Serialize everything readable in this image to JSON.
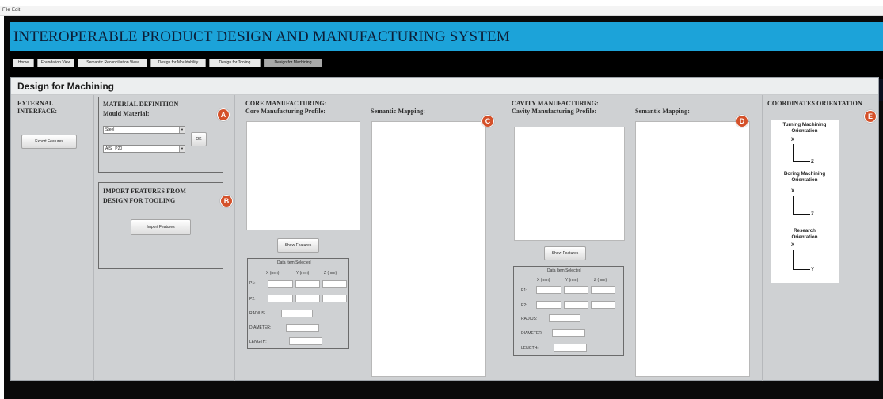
{
  "menu": {
    "file": "File",
    "edit": "Edit"
  },
  "app": {
    "title": "INTEROPERABLE PRODUCT DESIGN AND MANUFACTURING SYSTEM"
  },
  "nav": {
    "tabs": [
      {
        "label": "Home"
      },
      {
        "label": "Foundation View"
      },
      {
        "label": "Semantic Reconciliation View"
      },
      {
        "label": "Design for Mouldability"
      },
      {
        "label": "Design for Tooling"
      },
      {
        "label": "Design for Machining"
      }
    ],
    "active": "Design for Machining"
  },
  "page": {
    "title": "Design for Machining"
  },
  "external": {
    "heading_line1": "EXTERNAL",
    "heading_line2": "INTERFACE:",
    "export_button": "Export Features"
  },
  "material": {
    "heading": "MATERIAL DEFINITION",
    "mould_label": "Mould Material:",
    "material_value": "Steel",
    "grade_value": "AISI_P20",
    "ok_button": "OK"
  },
  "import": {
    "heading_line1": "IMPORT FEATURES FROM",
    "heading_line2": "DESIGN FOR TOOLING",
    "import_button": "Import Features"
  },
  "core": {
    "heading": "CORE MANUFACTURING:",
    "profile_label": "Core Manufacturing Profile:",
    "mapping_label": "Semantic Mapping:",
    "show_button": "Show Features",
    "data_title": "Data Item Selected",
    "x_label": "X (mm)",
    "y_label": "Y (mm)",
    "z_label": "Z (mm)",
    "p1": "P1:",
    "p2": "P2:",
    "radius": "RADIUS:",
    "diameter": "DIAMETER:",
    "length": "LENGTH:"
  },
  "cavity": {
    "heading": "CAVITY MANUFACTURING:",
    "profile_label": "Cavity Manufacturing Profile:",
    "mapping_label": "Semantic Mapping:",
    "show_button": "Show Features",
    "data_title": "Data Item Selected",
    "x_label": "X (mm)",
    "y_label": "Y (mm)",
    "z_label": "Z (mm)",
    "p1": "P1:",
    "p2": "P2:",
    "radius": "RADIUS:",
    "diameter": "DIAMETER:",
    "length": "LENGTH:"
  },
  "coordinates": {
    "heading": "COORDINATES ORIENTATION",
    "turning_line1": "Turning Machining",
    "turning_line2": "Orientation",
    "boring_line1": "Boring Machining",
    "boring_line2": "Orientation",
    "research_line1": "Research",
    "research_line2": "Orientation",
    "axis_x": "X",
    "axis_z": "Z",
    "axis_y": "Y"
  },
  "markers": {
    "a": "A",
    "b": "B",
    "c": "C",
    "d": "D",
    "e": "E"
  },
  "colors": {
    "title_bar": "#1ca3d9",
    "marker": "#d4512a",
    "panel_bg": "#cfd1d3"
  }
}
